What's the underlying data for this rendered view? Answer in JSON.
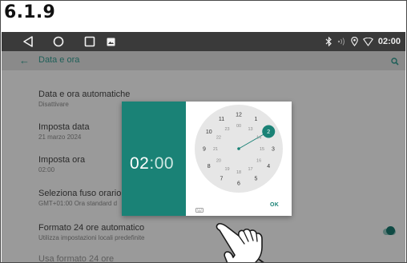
{
  "section_label": "6.1.9",
  "status_bar": {
    "time": "02:00",
    "icons": [
      "bluetooth-icon",
      "signal-icon",
      "location-icon",
      "wifi-icon"
    ]
  },
  "nav_bar": {
    "icons": [
      "back-triangle-icon",
      "home-circle-icon",
      "recents-square-icon",
      "gallery-icon"
    ]
  },
  "toolbar": {
    "title": "Data e ora"
  },
  "settings": {
    "auto": {
      "title": "Data e ora automatiche",
      "sub": "Disattivare"
    },
    "date": {
      "title": "Imposta data",
      "sub": "21 marzo 2024"
    },
    "time": {
      "title": "Imposta ora",
      "sub": "02:00"
    },
    "tz": {
      "title": "Seleziona fuso orario",
      "sub": "GMT+01:00 Ora standard d"
    },
    "fmt24": {
      "title": "Formato 24 ore automatico",
      "sub": "Utilizza impostazioni locali predefinite",
      "enabled": true
    },
    "use24": {
      "title": "Usa formato 24 ore"
    }
  },
  "time_dialog": {
    "hour": "02",
    "separator": ":",
    "minute": "00",
    "ok_label": "OK",
    "selected_hour": "2",
    "outer_hours": [
      "12",
      "1",
      "2",
      "3",
      "4",
      "5",
      "6",
      "7",
      "8",
      "9",
      "10",
      "11"
    ],
    "inner_hours": [
      "00",
      "13",
      "14",
      "15",
      "16",
      "17",
      "18",
      "19",
      "20",
      "21",
      "22",
      "23"
    ]
  },
  "colors": {
    "accent": "#1a8276",
    "screen_bg": "#9a9a9a",
    "nav_bg": "#3a3a3a",
    "accent_text": "#1e5f58"
  }
}
